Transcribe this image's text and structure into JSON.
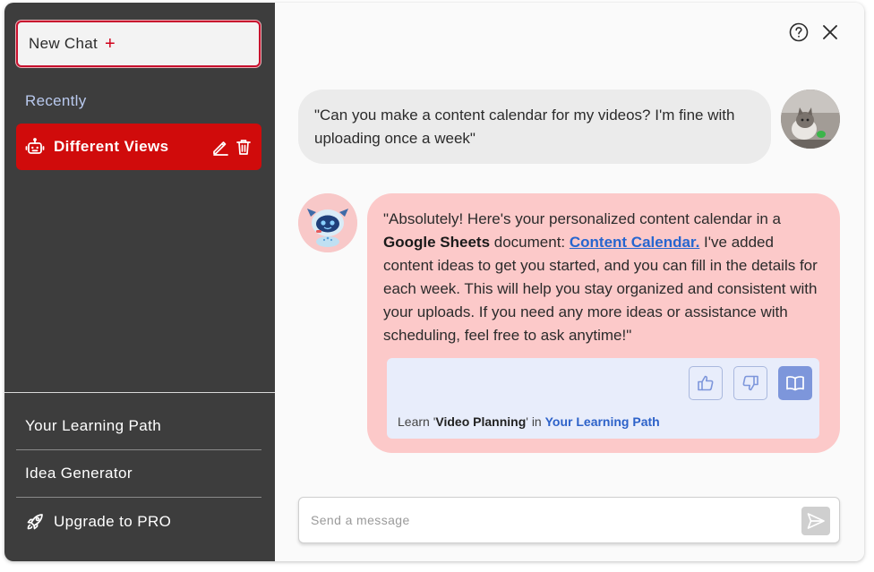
{
  "sidebar": {
    "new_chat_label": "New Chat",
    "new_chat_icon": "+",
    "recently_label": "Recently",
    "chats": [
      {
        "title": "Different Views",
        "icon": "robot-icon"
      }
    ],
    "links": [
      {
        "label": "Your Learning Path"
      },
      {
        "label": "Idea Generator"
      },
      {
        "label": "Upgrade to PRO",
        "icon": "rocket-icon"
      }
    ]
  },
  "header": {
    "help_icon": "help-icon",
    "close_icon": "close-icon"
  },
  "messages": {
    "user": {
      "text": "\"Can you make a content calendar for my videos? I'm fine with uploading once a week\"",
      "avatar": "cat-avatar"
    },
    "bot": {
      "avatar": "robot-avatar",
      "text_part1": "\"Absolutely! Here's your personalized content calendar in a ",
      "text_bold": "Google Sheets",
      "text_part2": " document: ",
      "link_text": "Content Calendar.",
      "text_part3": " I've added content ideas to get you started, and you can fill in the details for each week. This will help you stay organized and consistent with your uploads. If you need any more ideas or assistance with scheduling, feel free to ask anytime!\"",
      "learn": {
        "prefix": "Learn '",
        "topic": "Video Planning",
        "middle": "' in ",
        "path_link": "Your Learning Path"
      }
    }
  },
  "input": {
    "placeholder": "Send a message",
    "value": ""
  },
  "colors": {
    "sidebar_bg": "#3d3d3d",
    "accent_red": "#d00b0b",
    "user_bubble": "#ebebeb",
    "bot_bubble": "#fcc9c9",
    "link_blue": "#2766cf"
  }
}
